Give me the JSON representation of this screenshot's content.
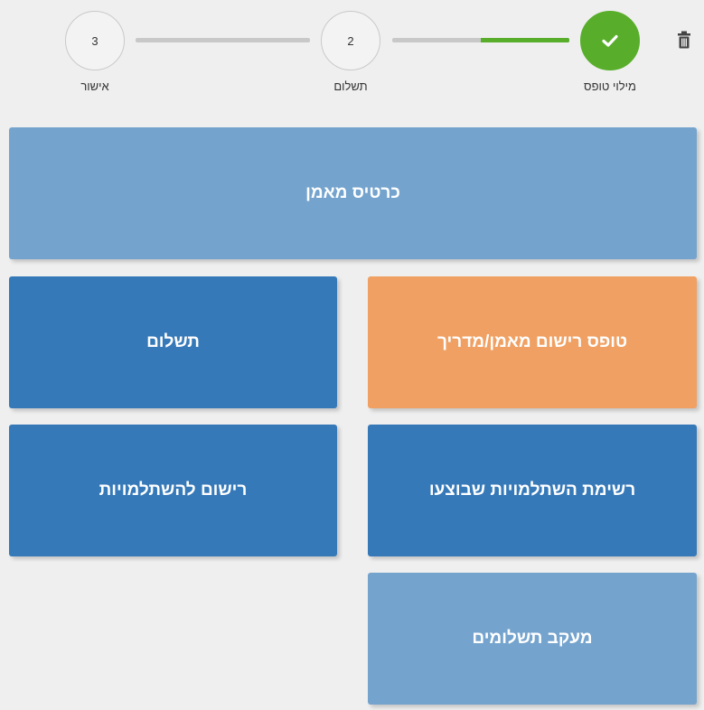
{
  "toolbar": {
    "delete_icon": "trash-icon"
  },
  "stepper": {
    "steps": [
      {
        "number": "",
        "label": "מילוי טופס",
        "status": "completed",
        "icon": "check-icon"
      },
      {
        "number": "2",
        "label": "תשלום",
        "status": "pending"
      },
      {
        "number": "3",
        "label": "אישור",
        "status": "pending"
      }
    ],
    "progress": {
      "connector_1_fill": 0.5,
      "connector_2_fill": 0
    },
    "colors": {
      "complete": "#58ae2a",
      "track": "#c8c8c8"
    }
  },
  "tiles": {
    "trainer_card": "כרטיס מאמן",
    "registration_form": "טופס רישום מאמן/מדריך",
    "payment": "תשלום",
    "completed_courses": "רשימת השתלמויות שבוצעו",
    "course_registration": "רישום להשתלמויות",
    "payment_tracking": "מעקב תשלומים"
  },
  "colors": {
    "light_blue": "#74a3cd",
    "blue": "#3679b8",
    "orange": "#f0a062",
    "background": "#efefef"
  }
}
